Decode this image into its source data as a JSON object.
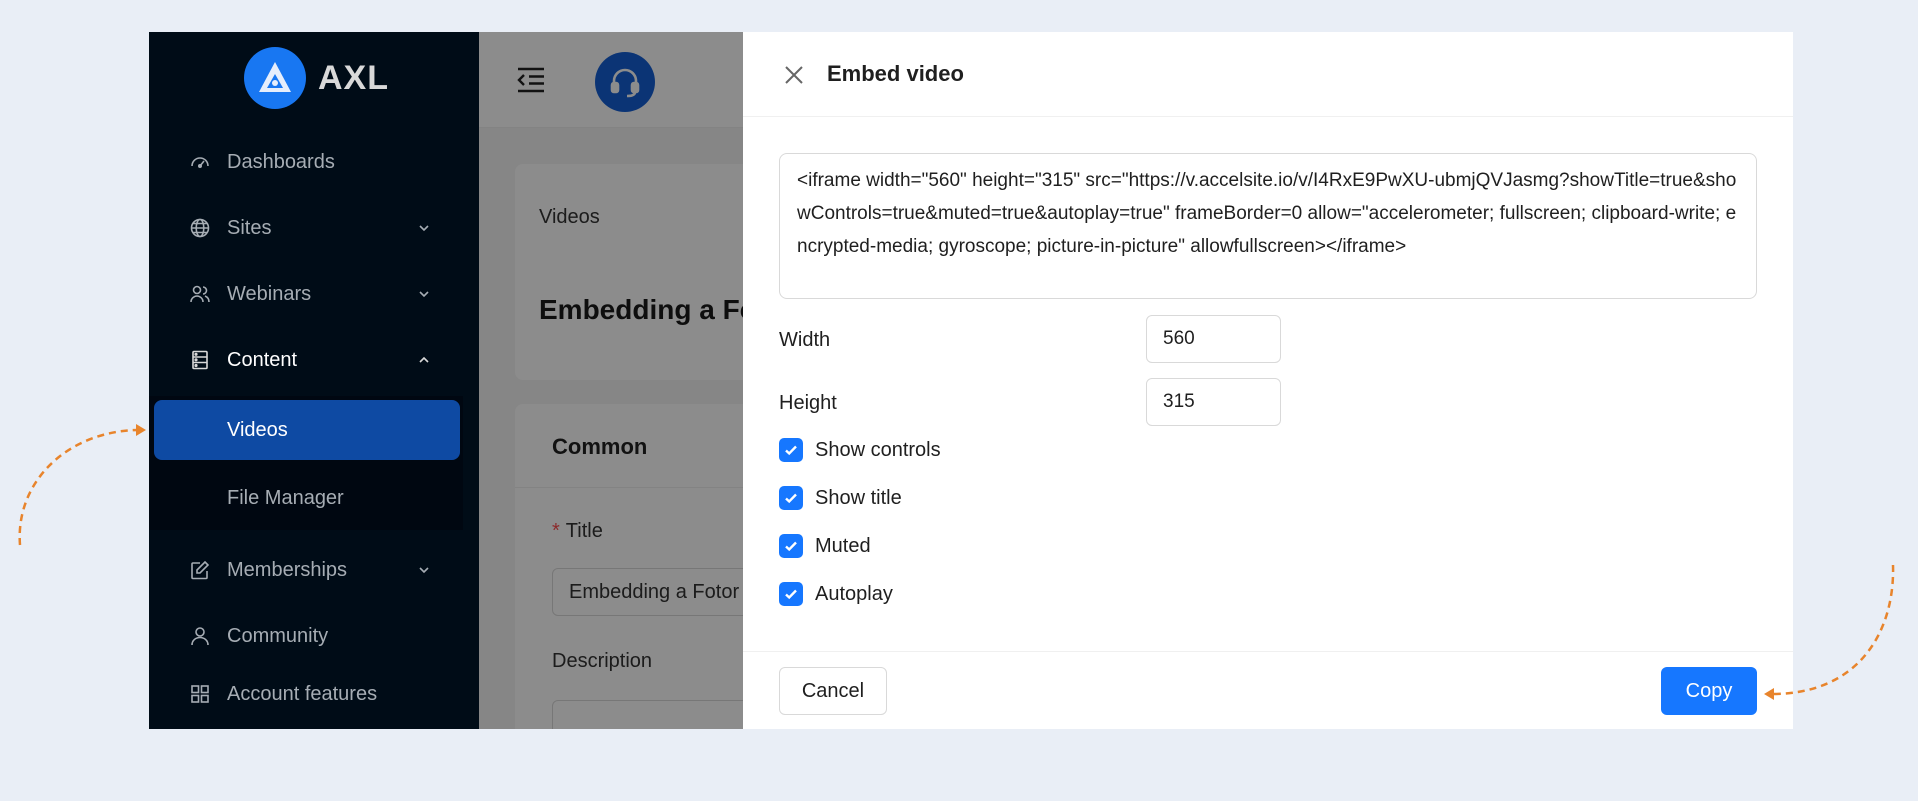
{
  "brand": {
    "name": "AXL"
  },
  "sidebar": {
    "items": [
      {
        "label": "Dashboards",
        "icon": "dashboard-icon"
      },
      {
        "label": "Sites",
        "icon": "globe-icon"
      },
      {
        "label": "Webinars",
        "icon": "users-icon"
      },
      {
        "label": "Content",
        "icon": "database-icon"
      },
      {
        "label": "Memberships",
        "icon": "edit-icon"
      },
      {
        "label": "Community",
        "icon": "user-icon"
      },
      {
        "label": "Account features",
        "icon": "grid-icon"
      }
    ],
    "submenu": [
      {
        "label": "Videos",
        "active": true
      },
      {
        "label": "File Manager",
        "active": false
      }
    ]
  },
  "main": {
    "breadcrumb": "Videos",
    "page_title": "Embedding a Fotor",
    "section_title": "Common",
    "title_label": "Title",
    "title_value": "Embedding a Fotor",
    "description_label": "Description"
  },
  "drawer": {
    "title": "Embed video",
    "embed_code": "<iframe width=\"560\" height=\"315\" src=\"https://v.accelsite.io/v/I4RxE9PwXU-ubmjQVJasmg?showTitle=true&showControls=true&muted=true&autoplay=true\" frameBorder=0 allow=\"accelerometer; fullscreen; clipboard-write; encrypted-media; gyroscope; picture-in-picture\" allowfullscreen></iframe>",
    "width_label": "Width",
    "width_value": "560",
    "height_label": "Height",
    "height_value": "315",
    "options": [
      {
        "label": "Show controls",
        "checked": true
      },
      {
        "label": "Show title",
        "checked": true
      },
      {
        "label": "Muted",
        "checked": true
      },
      {
        "label": "Autoplay",
        "checked": true
      }
    ],
    "cancel_label": "Cancel",
    "copy_label": "Copy"
  },
  "colors": {
    "page_bg": "#e9eef6",
    "sidebar_bg": "#000c17",
    "active_item": "#0e4aa3",
    "primary": "#1677ff",
    "annotation_arrow": "#e8842c"
  }
}
